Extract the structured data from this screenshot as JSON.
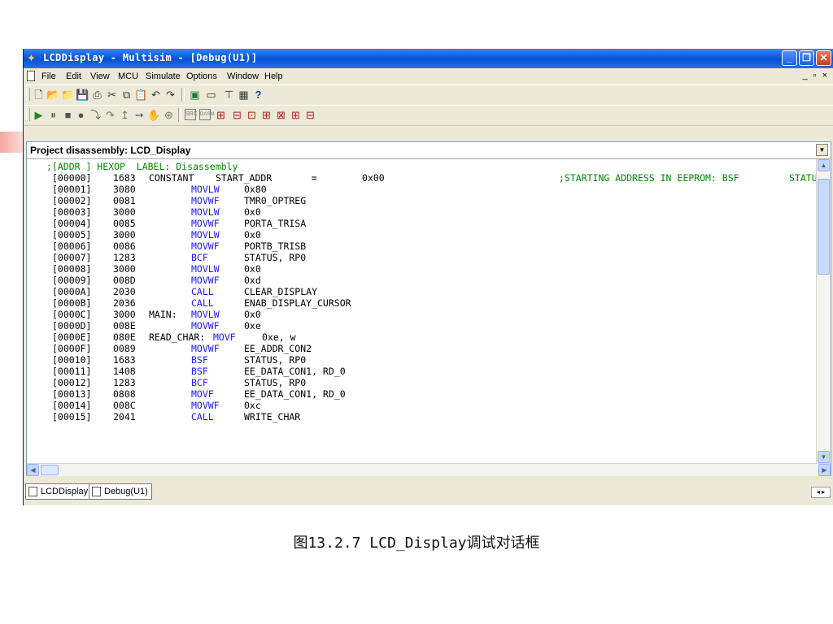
{
  "window": {
    "title": "LCDDisplay - Multisim - [Debug(U1)]",
    "controls": {
      "minimize": "_",
      "restore": "❐",
      "close": "✕"
    }
  },
  "menubar": {
    "items": [
      "File",
      "Edit",
      "View",
      "MCU",
      "Simulate",
      "Options",
      "Window",
      "Help"
    ],
    "mdi_controls": "_ ▫ ×"
  },
  "toolbar1": {
    "icons": [
      "new-icon",
      "open-icon",
      "open-folder-icon",
      "save-icon",
      "print-icon",
      "cut-icon",
      "copy-icon",
      "paste-icon",
      "undo-icon",
      "redo-icon",
      "component-icon",
      "rect-icon",
      "tree-icon",
      "grid-icon",
      "help-icon"
    ],
    "help_label": "?"
  },
  "toolbar2": {
    "icons": [
      "run-icon",
      "pause-icon",
      "stop-icon",
      "breakpoint-icon",
      "step-into-icon",
      "step-over-icon",
      "step-out-icon",
      "run-to-cursor-icon",
      "toggle-breakpoint-icon",
      "src-view-icon",
      "disasm-view-icon",
      "debug-icon-1",
      "debug-icon-2",
      "debug-icon-3",
      "debug-icon-4",
      "debug-icon-5",
      "debug-icon-6",
      "debug-icon-7"
    ],
    "src_label": "SRC",
    "disasm_label": "DASM"
  },
  "panel": {
    "title": "Project disassembly: LCD_Display",
    "header_line": ";[ADDR ] HEXOP  LABEL: Disassembly",
    "lines": [
      {
        "addr": "[00000]",
        "hex": "1683",
        "label": "CONSTANT",
        "op": "",
        "arg": "START_ADDR       =        0x00",
        "comment": ";STARTING ADDRESS IN EEPROM: BSF",
        "comment2": "STATU"
      },
      {
        "addr": "[00001]",
        "hex": "3080",
        "label": "",
        "op": "MOVLW",
        "arg": "0x80"
      },
      {
        "addr": "[00002]",
        "hex": "0081",
        "label": "",
        "op": "MOVWF",
        "arg": "TMR0_OPTREG"
      },
      {
        "addr": "[00003]",
        "hex": "3000",
        "label": "",
        "op": "MOVLW",
        "arg": "0x0"
      },
      {
        "addr": "[00004]",
        "hex": "0085",
        "label": "",
        "op": "MOVWF",
        "arg": "PORTA_TRISA"
      },
      {
        "addr": "[00005]",
        "hex": "3000",
        "label": "",
        "op": "MOVLW",
        "arg": "0x0"
      },
      {
        "addr": "[00006]",
        "hex": "0086",
        "label": "",
        "op": "MOVWF",
        "arg": "PORTB_TRISB"
      },
      {
        "addr": "[00007]",
        "hex": "1283",
        "label": "",
        "op": "BCF",
        "arg": "STATUS, RP0"
      },
      {
        "addr": "[00008]",
        "hex": "3000",
        "label": "",
        "op": "MOVLW",
        "arg": "0x0"
      },
      {
        "addr": "[00009]",
        "hex": "008D",
        "label": "",
        "op": "MOVWF",
        "arg": "0xd"
      },
      {
        "addr": "[0000A]",
        "hex": "2030",
        "label": "",
        "op": "CALL",
        "arg": "CLEAR_DISPLAY"
      },
      {
        "addr": "[0000B]",
        "hex": "2036",
        "label": "",
        "op": "CALL",
        "arg": "ENAB_DISPLAY_CURSOR"
      },
      {
        "addr": "[0000C]",
        "hex": "3000",
        "label": "MAIN:",
        "op": "MOVLW",
        "arg": "0x0"
      },
      {
        "addr": "[0000D]",
        "hex": "008E",
        "label": "",
        "op": "MOVWF",
        "arg": "0xe"
      },
      {
        "addr": "[0000E]",
        "hex": "080E",
        "label": "READ_CHAR:",
        "op": "MOVF",
        "arg": "0xe, w",
        "inline": true
      },
      {
        "addr": "[0000F]",
        "hex": "0089",
        "label": "",
        "op": "MOVWF",
        "arg": "EE_ADDR_CON2"
      },
      {
        "addr": "[00010]",
        "hex": "1683",
        "label": "",
        "op": "BSF",
        "arg": "STATUS, RP0"
      },
      {
        "addr": "[00011]",
        "hex": "1408",
        "label": "",
        "op": "BSF",
        "arg": "EE_DATA_CON1, RD_0"
      },
      {
        "addr": "[00012]",
        "hex": "1283",
        "label": "",
        "op": "BCF",
        "arg": "STATUS, RP0"
      },
      {
        "addr": "[00013]",
        "hex": "0808",
        "label": "",
        "op": "MOVF",
        "arg": "EE_DATA_CON1, RD_0"
      },
      {
        "addr": "[00014]",
        "hex": "008C",
        "label": "",
        "op": "MOVWF",
        "arg": "0xc"
      },
      {
        "addr": "[00015]",
        "hex": "2041",
        "label": "",
        "op": "CALL",
        "arg": "WRITE_CHAR"
      }
    ]
  },
  "tabs": [
    {
      "label": "LCDDisplay *"
    },
    {
      "label": "Debug(U1)"
    }
  ],
  "tab_nav": "◂ ▸",
  "caption": "图13.2.7 LCD_Display调试对话框",
  "colors": {
    "titlebar": "#0553d4",
    "opcode": "#1a1aff",
    "comment": "#008800"
  }
}
